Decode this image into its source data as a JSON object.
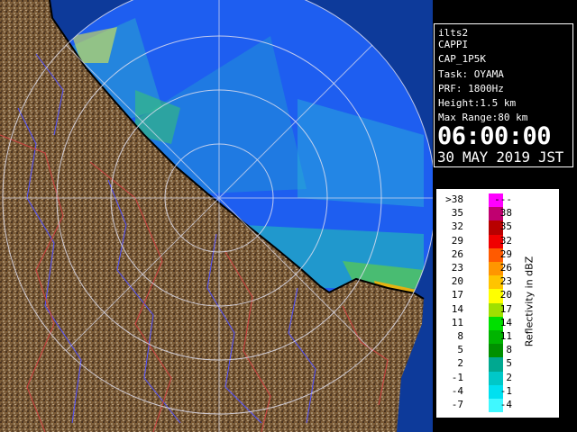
{
  "info": {
    "site": "ilts2",
    "product": "CAPPI",
    "product_code": "CAP_1P5K",
    "task": "Task: OYAMA",
    "prf": "PRF: 1800Hz",
    "height": "Height:1.5 km",
    "max_range": "Max Range:80 km",
    "time": "06:00:00",
    "date": "30 MAY 2019 JST"
  },
  "legend": {
    "title": "Reflectivity in dBZ",
    "rows": [
      {
        "lo": ">38",
        "hi": "---",
        "color": "#ff00ff"
      },
      {
        "lo": "35",
        "hi": "38",
        "color": "#c00070"
      },
      {
        "lo": "32",
        "hi": "35",
        "color": "#b80000"
      },
      {
        "lo": "29",
        "hi": "32",
        "color": "#f00000"
      },
      {
        "lo": "26",
        "hi": "29",
        "color": "#ff5a00"
      },
      {
        "lo": "23",
        "hi": "26",
        "color": "#ff9600"
      },
      {
        "lo": "20",
        "hi": "23",
        "color": "#ffc400"
      },
      {
        "lo": "17",
        "hi": "20",
        "color": "#ffff00"
      },
      {
        "lo": "14",
        "hi": "17",
        "color": "#a0e000"
      },
      {
        "lo": "11",
        "hi": "14",
        "color": "#00e000"
      },
      {
        "lo": "8",
        "hi": "11",
        "color": "#00b400"
      },
      {
        "lo": "5",
        "hi": "8",
        "color": "#009000"
      },
      {
        "lo": "2",
        "hi": "5",
        "color": "#00a890"
      },
      {
        "lo": "-1",
        "hi": "2",
        "color": "#00c8c8"
      },
      {
        "lo": "-4",
        "hi": "-1",
        "color": "#00e0f0"
      },
      {
        "lo": "-7",
        "hi": "-4",
        "color": "#40f8ff"
      }
    ]
  },
  "colors": {
    "sea": "#0d3a9a",
    "radar_background": "#1e5ef0",
    "land": "#7a5a36",
    "coastline": "#000000",
    "rivers": "#5050ff",
    "borders": "#d04040"
  }
}
